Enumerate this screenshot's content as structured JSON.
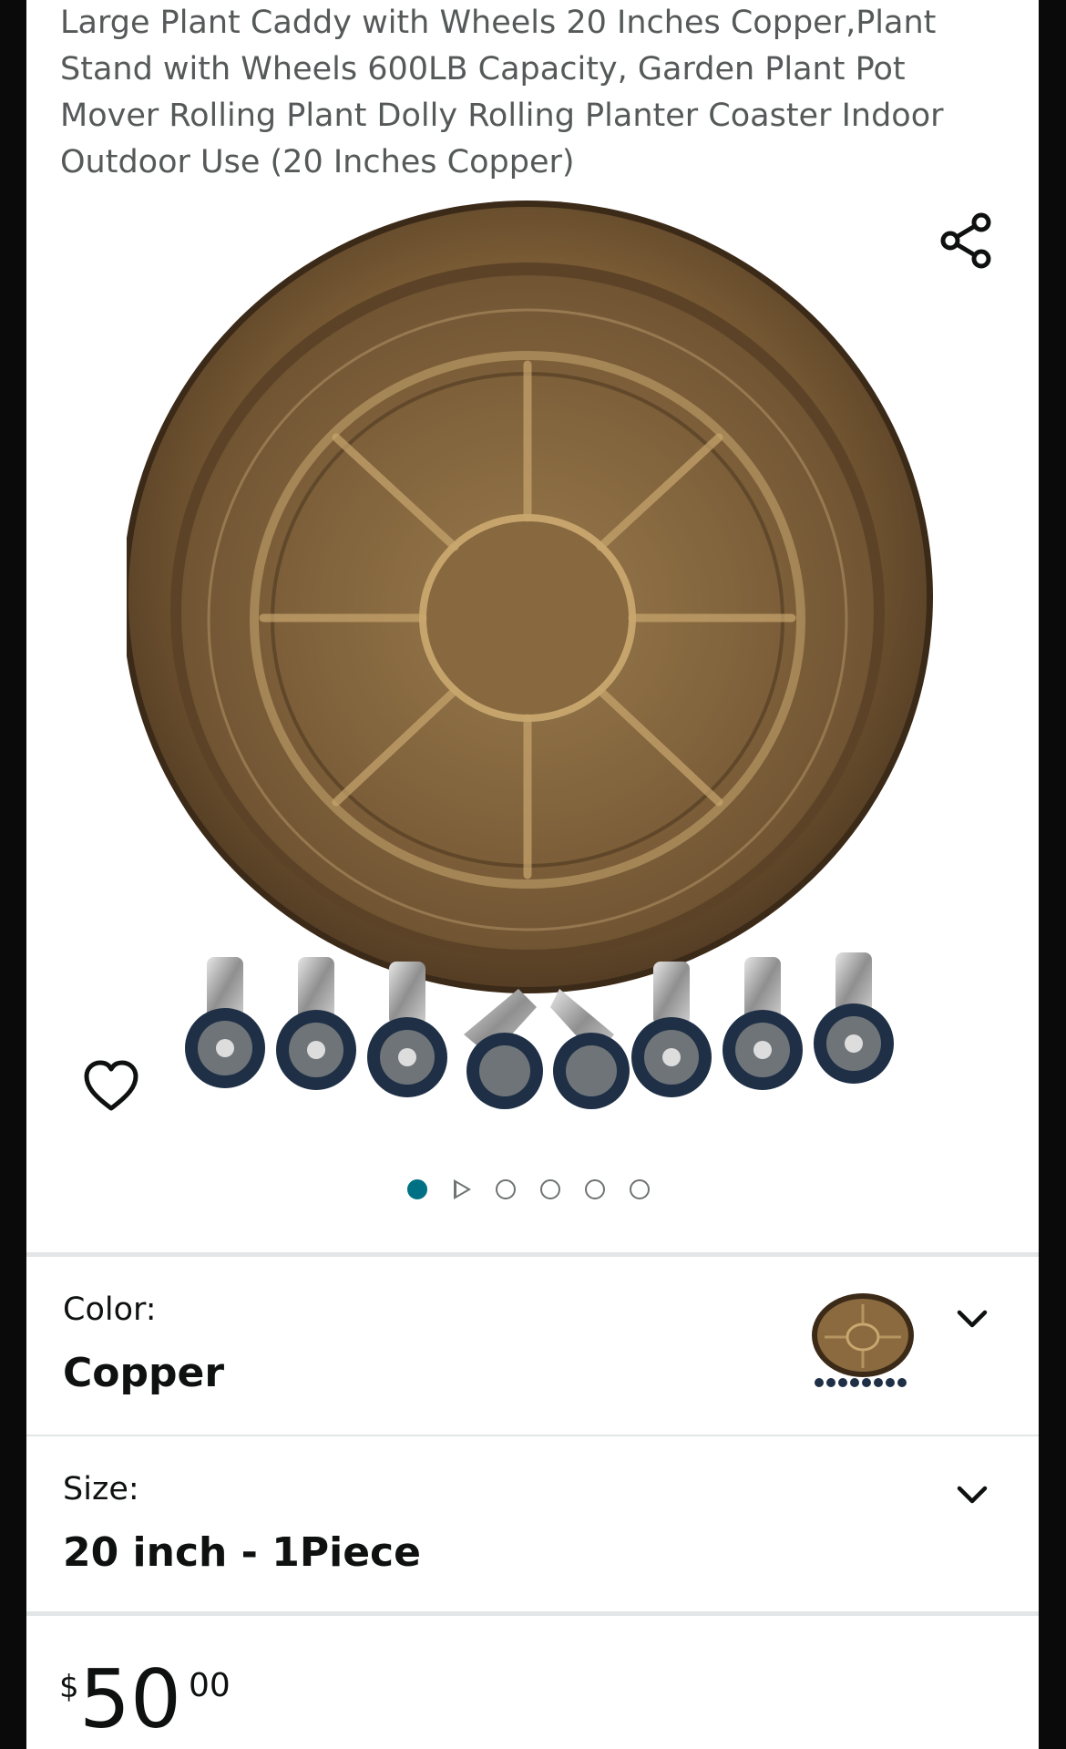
{
  "product": {
    "title": "Large Plant Caddy with Wheels 20 Inches Copper,Plant Stand with Wheels 600LB Capacity, Garden Plant Pot Mover Rolling Plant Dolly Rolling Planter Coaster Indoor Outdoor Use (20 Inches Copper)"
  },
  "media": {
    "image_subject": "copper plant caddy tray with eight caster wheels",
    "carousel_position": 1,
    "carousel_total_dots": 5,
    "has_video_indicator": true,
    "share_icon": "share-icon",
    "wishlist_icon": "heart-outline-icon"
  },
  "color_selector": {
    "label": "Color:",
    "value": "Copper",
    "icon": "chevron-down-icon"
  },
  "size_selector": {
    "label": "Size:",
    "value": "20 inch - 1Piece",
    "icon": "chevron-down-icon"
  },
  "price": {
    "symbol": "$",
    "whole": "50",
    "fraction": "00"
  },
  "colors": {
    "accent": "#007185",
    "text": "#0f1111",
    "muted": "#565959",
    "copper": "#8a6a3e"
  }
}
